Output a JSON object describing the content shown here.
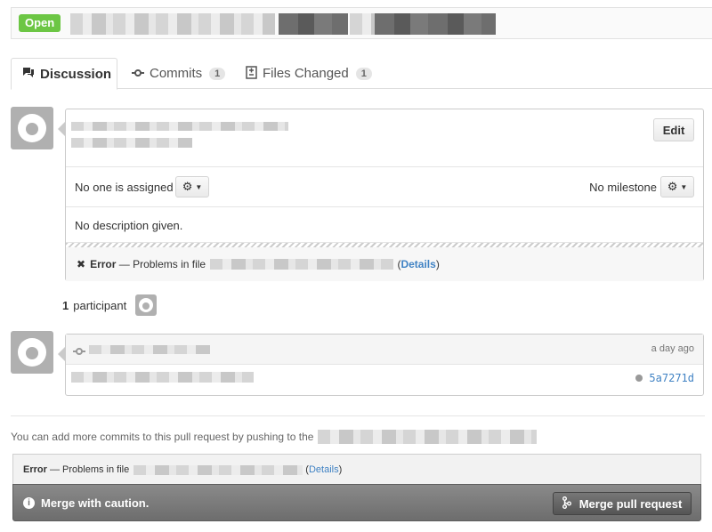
{
  "header": {
    "state": "Open",
    "number_fragment": "2"
  },
  "tabs": [
    {
      "label": "Discussion",
      "icon": "discussion-icon"
    },
    {
      "label": "Commits",
      "count": "1",
      "icon": "commit-icon"
    },
    {
      "label": "Files Changed",
      "count": "1",
      "icon": "diff-icon"
    }
  ],
  "discussion": {
    "edit_label": "Edit",
    "assignee_text": "No one is assigned",
    "milestone_text": "No milestone",
    "description": "No description given.",
    "error": {
      "label": "Error",
      "message": " — Problems in file ",
      "details_link": "Details"
    }
  },
  "participants": {
    "count": "1",
    "label": "participant"
  },
  "commit": {
    "time": "a day ago",
    "sha": "5a7271d"
  },
  "merge": {
    "info_text": "You can add more commits to this pull request by pushing to the",
    "error_label": "Error",
    "error_message": " — Problems in file ",
    "details_link": "Details",
    "caution_text": "Merge with caution.",
    "merge_button": "Merge pull request"
  },
  "colors": {
    "open_badge": "#6cc644",
    "link": "#4183c4"
  }
}
